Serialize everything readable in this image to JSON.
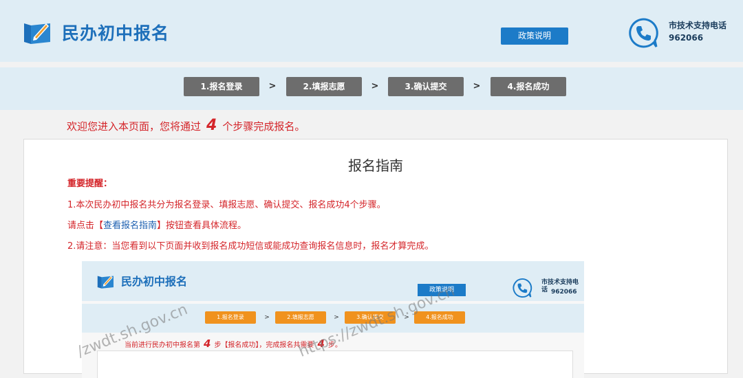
{
  "header": {
    "title": "民办初中报名",
    "policy_button": "政策说明",
    "support_label": "市技术支持电话",
    "support_number": "962066"
  },
  "steps": [
    "1.报名登录",
    "2.填报志愿",
    "3.确认提交",
    "4.报名成功"
  ],
  "welcome": {
    "prefix": "欢迎您进入本页面，您将通过",
    "count": "4",
    "suffix": "个步骤完成报名。"
  },
  "guide": {
    "title": "报名指南",
    "reminder_heading": "重要提醒：",
    "line1": "1.本次民办初中报名共分为报名登录、填报志愿、确认提交、报名成功4个步骤。",
    "line2_prefix": "请点击【",
    "line2_link": "查看报名指南",
    "line2_suffix": "】按钮查看具体流程。",
    "line3": "2.请注意：当您看到以下页面并收到报名成功短信或能成功查询报名信息时，报名才算完成。"
  },
  "example_screenshot": {
    "title": "民办初中报名",
    "policy_button": "政策说明",
    "support_label": "市技术支持电话",
    "support_number": "962066",
    "steps": [
      "1.报名登录",
      "2.填报志愿",
      "3.确认提交",
      "4.报名成功"
    ],
    "status_prefix": "当前进行民办初中报名第",
    "status_step": "4",
    "status_middle": "步【报名成功】，完成报名共需要",
    "status_total": "4",
    "status_suffix": "步。"
  },
  "watermarks": [
    "/zwdt.sh.gov.cn",
    "https://zwdt.sh.gov.cn"
  ],
  "colors": {
    "header_bg": "#dfedf5",
    "brand_blue": "#1d6fba",
    "button_blue": "#1c7bc8",
    "step_gray": "#6d6d6d",
    "step_orange": "#f0921e",
    "alert_red": "#d4252a"
  }
}
